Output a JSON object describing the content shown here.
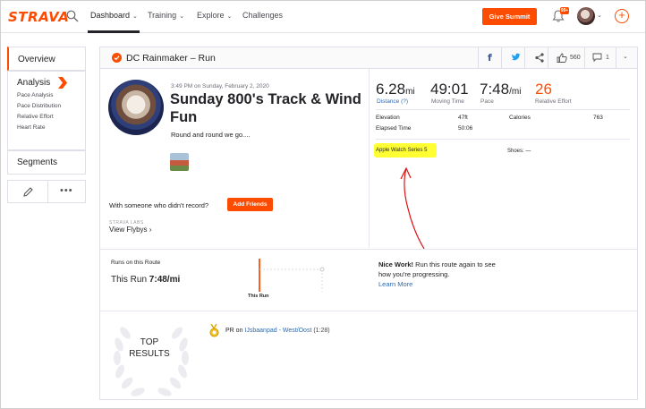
{
  "nav": {
    "logo": "STRAVA",
    "items": [
      {
        "label": "Dashboard",
        "chev": "⌄"
      },
      {
        "label": "Training",
        "chev": "⌄"
      },
      {
        "label": "Explore",
        "chev": "⌄"
      },
      {
        "label": "Challenges"
      }
    ],
    "give_summit": "Give Summit",
    "notification_count": "99+",
    "accent_color": "#fc4c02"
  },
  "sidebar": {
    "overview": "Overview",
    "analysis": "Analysis",
    "analysis_items": [
      "Pace Analysis",
      "Pace Distribution",
      "Relative Effort",
      "Heart Rate"
    ],
    "segments": "Segments",
    "more": "•••"
  },
  "activity": {
    "header_title": "DC Rainmaker – Run",
    "kudos_count": "560",
    "comment_count": "1",
    "date": "3:49 PM on Sunday, February 2, 2020",
    "title": "Sunday 800's Track & Wind Fun",
    "description": "Round and round we go....",
    "with_someone": "With someone who didn't record?",
    "add_friends": "Add Friends",
    "labs": "STRAVA LABS",
    "view_flybys": "View Flybys",
    "view_flybys_chev": "›"
  },
  "stats": {
    "distance": {
      "value": "6.28",
      "unit": "mi",
      "label": "Distance (?)"
    },
    "moving_time": {
      "value": "49:01",
      "label": "Moving Time"
    },
    "pace": {
      "value": "7:48",
      "unit": "/mi",
      "label": "Pace"
    },
    "relative_effort": {
      "value": "26",
      "label": "Relative Effort"
    },
    "elevation_label": "Elevation",
    "elevation_value": "47ft",
    "calories_label": "Calories",
    "calories_value": "763",
    "elapsed_label": "Elapsed Time",
    "elapsed_value": "50:06",
    "device": "Apple Watch Series 5",
    "shoes": "Shoes: —"
  },
  "route": {
    "runs_label": "Runs on this Route",
    "this_run_prefix": "This Run",
    "this_run_pace": "7:48/mi",
    "tick_label": "This Run",
    "nice_work_bold": "Nice Work!",
    "nice_work_text": " Run this route again to see how you're progressing.",
    "learn_more": "Learn More"
  },
  "results": {
    "top_results_line1": "TOP",
    "top_results_line2": "RESULTS",
    "pr_prefix": "PR",
    "pr_on": " on ",
    "segment": "IJsbaanpad - West/Oost",
    "time": " (1:28)"
  }
}
